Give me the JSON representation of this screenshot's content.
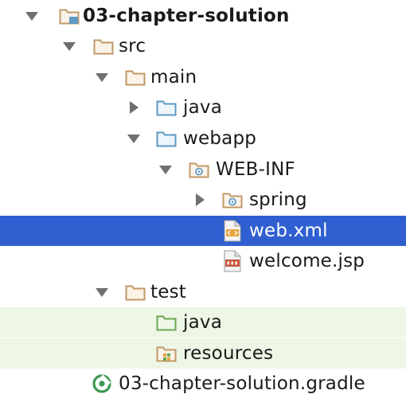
{
  "colors": {
    "selection": "#2f5fd0",
    "test_background": "#eef6e6",
    "folder_tan": "#c29867",
    "folder_blue": "#5d99c5",
    "folder_green": "#6aa84f",
    "twisty": "#6f6f6f",
    "gradle_green": "#3d9a53"
  },
  "tree": {
    "project": {
      "label": "03-chapter-solution",
      "expanded": true,
      "icon": "project-folder-icon"
    },
    "src": {
      "label": "src",
      "expanded": true,
      "icon": "folder-icon"
    },
    "main": {
      "label": "main",
      "expanded": true,
      "icon": "folder-icon"
    },
    "main_java": {
      "label": "java",
      "expanded": false,
      "icon": "source-folder-icon"
    },
    "webapp": {
      "label": "webapp",
      "expanded": true,
      "icon": "web-folder-icon"
    },
    "web_inf": {
      "label": "WEB-INF",
      "expanded": true,
      "icon": "web-folder-icon"
    },
    "spring": {
      "label": "spring",
      "expanded": false,
      "icon": "web-folder-icon"
    },
    "web_xml": {
      "label": "web.xml",
      "selected": true,
      "icon": "xml-file-icon"
    },
    "welcome_jsp": {
      "label": "welcome.jsp",
      "icon": "jsp-file-icon"
    },
    "test": {
      "label": "test",
      "expanded": true,
      "icon": "folder-icon"
    },
    "test_java": {
      "label": "java",
      "icon": "test-source-folder-icon"
    },
    "test_resources": {
      "label": "resources",
      "icon": "test-resources-folder-icon"
    },
    "gradle_file": {
      "label": "03-chapter-solution.gradle",
      "icon": "gradle-file-icon"
    }
  }
}
